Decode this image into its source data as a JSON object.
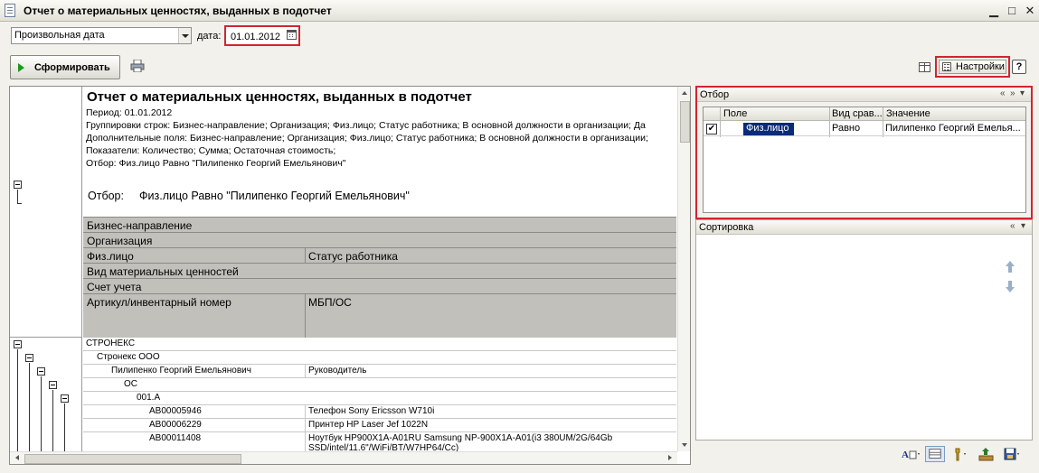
{
  "window": {
    "title": "Отчет о материальных ценностях, выданных в подотчет",
    "minimize_glyph": "▁",
    "maximize_glyph": "□",
    "close_glyph": "✕"
  },
  "toolbar": {
    "period_mode": "Произвольная дата",
    "date_label": "дата:",
    "date_value": "01.01.2012",
    "generate_label": "Сформировать",
    "settings_label": "Настройки",
    "help_label": "?"
  },
  "report": {
    "title": "Отчет о материальных ценностях, выданных в подотчет",
    "period": "Период: 01.01.2012",
    "groupings": "Группировки строк: Бизнес-направление; Организация; Физ.лицо; Статус работника; В основной должности в организации; Да",
    "extra_fields": "Дополнительные поля: Бизнес-направление; Организация; Физ.лицо; Статус работника; В основной должности в организации;",
    "indicators": "Показатели: Количество; Сумма; Остаточная стоимость;",
    "filter_line": "Отбор: Физ.лицо Равно \"Пилипенко Георгий Емельянович\"",
    "filter_caption": "Отбор:",
    "filter_value": "Физ.лицо Равно \"Пилипенко Георгий Емельянович\"",
    "header": {
      "business": "Бизнес-направление",
      "organization": "Организация",
      "person": "Физ.лицо",
      "status": "Статус работника",
      "asset_type": "Вид материальных ценностей",
      "account": "Счет учета",
      "article": "Артикул/инвентарный номер",
      "mbp": "МБП/ОС"
    },
    "rows": [
      {
        "c1": "СТРОНЕКС",
        "c2": ""
      },
      {
        "c1": "Стронекс ООО",
        "c2": ""
      },
      {
        "c1": "Пилипенко Георгий Емельянович",
        "c2": "Руководитель"
      },
      {
        "c1": "ОС",
        "c2": ""
      },
      {
        "c1": "001.А",
        "c2": ""
      },
      {
        "c1": "АВ00005946",
        "c2": "Телефон  Sony Ericsson W710i"
      },
      {
        "c1": "АВ00006229",
        "c2": "Принтер HP Laser Jef 1022N"
      },
      {
        "c1": "АВ00011408",
        "c2": "Ноутбук HP900X1A-A01RU Samsung NP-900X1A-A01(i3 380UM/2G/64Gb"
      },
      {
        "c1": "",
        "c2": "SSD/intel/11.6\"/WiFi/BT/W7HP64/Cc)"
      }
    ]
  },
  "filter_panel": {
    "title": "Отбор",
    "columns": {
      "field": "Поле",
      "comparison": "Вид срав...",
      "value": "Значение"
    },
    "row": {
      "checked": true,
      "check_glyph": "✔",
      "field": "Физ.лицо",
      "comparison": "Равно",
      "value": "Пилипенко Георгий Емелья..."
    }
  },
  "sort_panel": {
    "title": "Сортировка"
  },
  "panel_controls": {
    "collapse": "«",
    "expand": "»",
    "menu": "▾"
  },
  "colors": {
    "highlight_border": "#d1252f",
    "selected_field_bg": "#0a2a7a",
    "header_gray": "#c1c0bb"
  }
}
